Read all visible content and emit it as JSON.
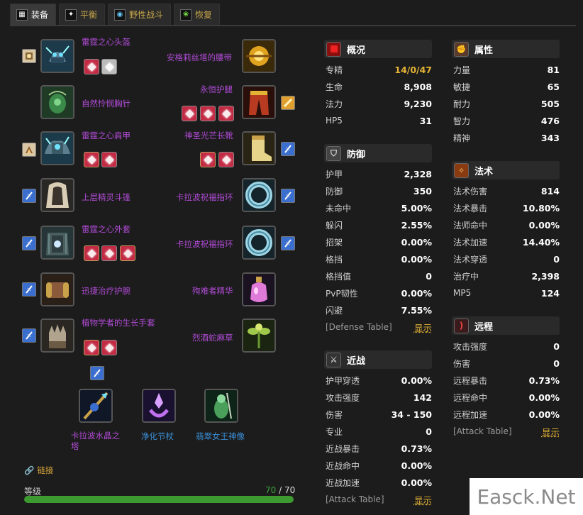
{
  "tabs": [
    {
      "label": "装备",
      "icon": "gear-tab-icon"
    },
    {
      "label": "平衡",
      "icon": "balance-tab-icon"
    },
    {
      "label": "野性战斗",
      "icon": "feral-tab-icon"
    },
    {
      "label": "恢复",
      "icon": "restoration-tab-icon"
    }
  ],
  "gear": {
    "head": "雷霆之心头盔",
    "neck": "自然怜悯胸针",
    "shoulder": "雷霆之心肩甲",
    "back": "上层精灵斗篷",
    "chest": "雷霆之心外套",
    "wrist": "迅捷治疗护腕",
    "hands": "植物学者的生长手套",
    "waist": "安格莉丝塔的腰带",
    "legs": "永恒护腿",
    "feet": "神圣光芒长靴",
    "ring1": "卡拉波祝福指环",
    "ring2": "卡拉波祝福指环",
    "trinket1": "殉难者精华",
    "trinket2": "烈酒蛇麻草",
    "mainhand": "卡拉波水晶之塔",
    "offhand": "净化节杖",
    "relic": "翡翠女王神像"
  },
  "links": {
    "label": "链接"
  },
  "level": {
    "label": "等级",
    "current": "70",
    "sep": " / ",
    "max": "70",
    "fill_fraction": 1.0
  },
  "overview": {
    "title": "概况",
    "rows": [
      {
        "k": "专精",
        "v": "14/0/47"
      },
      {
        "k": "生命",
        "v": "8,908"
      },
      {
        "k": "法力",
        "v": "9,230"
      },
      {
        "k": "HP5",
        "v": "31"
      }
    ]
  },
  "defense": {
    "title": "防御",
    "rows": [
      {
        "k": "护甲",
        "v": "2,328"
      },
      {
        "k": "防御",
        "v": "350"
      },
      {
        "k": "未命中",
        "v": "5.00%"
      },
      {
        "k": "躲闪",
        "v": "2.55%"
      },
      {
        "k": "招架",
        "v": "0.00%"
      },
      {
        "k": "格挡",
        "v": "0.00%"
      },
      {
        "k": "格挡值",
        "v": "0"
      },
      {
        "k": "PvP韧性",
        "v": "0.00%"
      },
      {
        "k": "闪避",
        "v": "7.55%"
      }
    ],
    "table_label": "[Defense Table]",
    "show_label": "显示"
  },
  "melee": {
    "title": "近战",
    "rows": [
      {
        "k": "护甲穿透",
        "v": "0.00%"
      },
      {
        "k": "攻击强度",
        "v": "142"
      },
      {
        "k": "伤害",
        "v": "34 - 150"
      },
      {
        "k": "专业",
        "v": "0"
      },
      {
        "k": "近战暴击",
        "v": "0.73%"
      },
      {
        "k": "近战命中",
        "v": "0.00%"
      },
      {
        "k": "近战加速",
        "v": "0.00%"
      }
    ],
    "table_label": "[Attack Table]",
    "show_label": "显示"
  },
  "attributes": {
    "title": "属性",
    "rows": [
      {
        "k": "力量",
        "v": "81"
      },
      {
        "k": "敏捷",
        "v": "65"
      },
      {
        "k": "耐力",
        "v": "505"
      },
      {
        "k": "智力",
        "v": "476"
      },
      {
        "k": "精神",
        "v": "343"
      }
    ]
  },
  "spell": {
    "title": "法术",
    "rows": [
      {
        "k": "法术伤害",
        "v": "814"
      },
      {
        "k": "法术暴击",
        "v": "10.80%"
      },
      {
        "k": "法师命中",
        "v": "0.00%"
      },
      {
        "k": "法术加速",
        "v": "14.40%"
      },
      {
        "k": "法术穿透",
        "v": "0"
      },
      {
        "k": "治疗中",
        "v": "2,398"
      },
      {
        "k": "MP5",
        "v": "124"
      }
    ]
  },
  "ranged": {
    "title": "远程",
    "rows": [
      {
        "k": "攻击强度",
        "v": "0"
      },
      {
        "k": "伤害",
        "v": "0"
      },
      {
        "k": "远程暴击",
        "v": "0.73%"
      },
      {
        "k": "远程命中",
        "v": "0.00%"
      },
      {
        "k": "远程加速",
        "v": "0.00%"
      }
    ],
    "table_label": "[Attack Table]",
    "show_label": "显示"
  },
  "watermark": "Easck.Net",
  "colors": {
    "epic": "#b14bd6",
    "rare": "#3a8fd8",
    "gold": "#e3b335",
    "xp_bar": "#3d9a30"
  }
}
